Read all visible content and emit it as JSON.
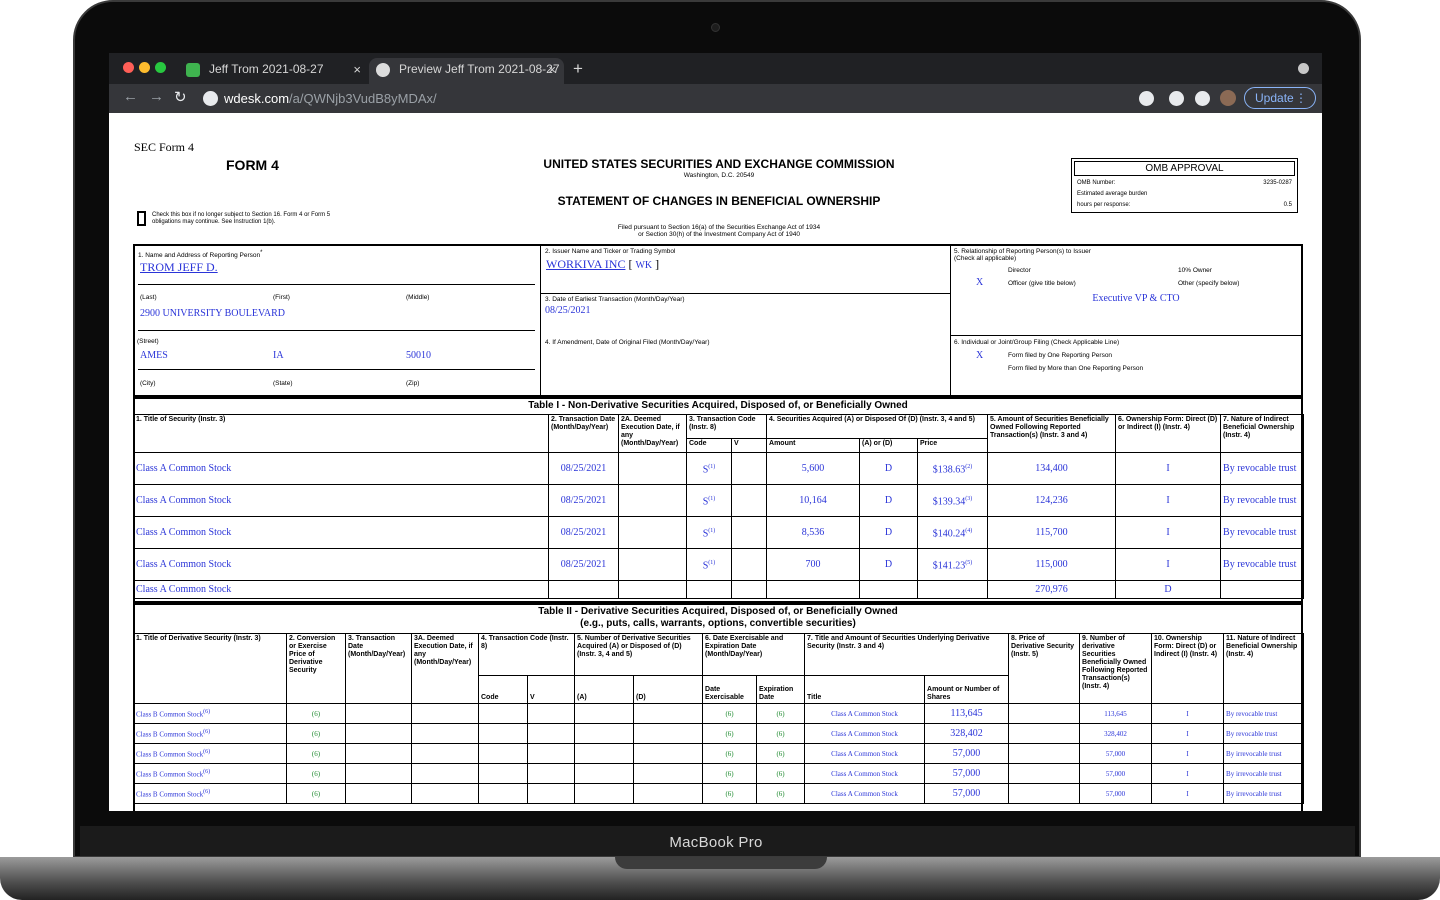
{
  "device": {
    "label": "MacBook Pro"
  },
  "browser": {
    "tabs": [
      {
        "label": "Jeff Trom 2021-08-27",
        "active": false
      },
      {
        "label": "Preview Jeff Trom 2021-08-27",
        "active": true
      }
    ],
    "url_domain": "wdesk.com",
    "url_path": "/a/QWNjb3VudB8yMDAx/",
    "update_label": "Update",
    "new_tab": "+",
    "close": "×",
    "icons": [
      "back-icon",
      "forward-icon",
      "reload-icon",
      "site-info-icon",
      "extension-icon",
      "profile-avatar",
      "menu-icon"
    ]
  },
  "form": {
    "sec_label": "SEC Form 4",
    "form_title": "FORM 4",
    "agency": "UNITED STATES SECURITIES AND EXCHANGE COMMISSION",
    "city": "Washington, D.C. 20549",
    "statement": "STATEMENT OF CHANGES IN BENEFICIAL OWNERSHIP",
    "filed1": "Filed pursuant to Section 16(a) of the Securities Exchange Act of 1934",
    "filed2": "or Section 30(h) of the Investment Company Act of 1940",
    "checkbox_text1": "Check this box if no longer subject to Section 16. Form 4 or Form 5",
    "checkbox_text2": "obligations may continue. See Instruction 1(b).",
    "omb": {
      "title": "OMB APPROVAL",
      "number_label": "OMB Number:",
      "number": "3235-0287",
      "burden_label": "Estimated average burden",
      "hours_label": "hours per response:",
      "hours": "0.5"
    },
    "box1": {
      "label": "1. Name and Address of Reporting Person",
      "mark": "*",
      "name": "TROM JEFF D.",
      "last": "(Last)",
      "first": "(First)",
      "middle": "(Middle)",
      "street_val": "2900 UNIVERSITY BOULEVARD",
      "street": "(Street)",
      "city_val": "AMES",
      "state_val": "IA",
      "zip_val": "50010",
      "city": "(City)",
      "state": "(State)",
      "zip": "(Zip)"
    },
    "box2": {
      "label": "2. Issuer Name and Ticker or Trading Symbol",
      "issuer": "WORKIVA INC",
      "ticker": "WK",
      "br_open": "[",
      "br_close": "]"
    },
    "box3": {
      "label": "3. Date of Earliest Transaction (Month/Day/Year)",
      "value": "08/25/2021"
    },
    "box4": {
      "label": "4. If Amendment, Date of Original Filed (Month/Day/Year)"
    },
    "box5": {
      "label1": "5. Relationship of Reporting Person(s) to Issuer",
      "label2": "(Check all applicable)",
      "director": "Director",
      "owner": "10% Owner",
      "x": "X",
      "officer": "Officer (give title below)",
      "other": "Other (specify below)",
      "title": "Executive VP & CTO"
    },
    "box6": {
      "label": "6. Individual or Joint/Group Filing (Check Applicable Line)",
      "x": "X",
      "one": "Form filed by One Reporting Person",
      "more": "Form filed by More than One Reporting Person"
    }
  },
  "table1": {
    "title": "Table I - Non-Derivative Securities Acquired, Disposed of, or Beneficially Owned",
    "headers": {
      "c1": "1. Title of Security (Instr. 3)",
      "c2": "2. Transaction Date (Month/Day/Year)",
      "c2a": "2A. Deemed Execution Date, if any (Month/Day/Year)",
      "c3": "3. Transaction Code (Instr. 8)",
      "c4": "4. Securities Acquired (A) or Disposed Of (D) (Instr. 3, 4 and 5)",
      "c5": "5. Amount of Securities Beneficially Owned Following Reported Transaction(s) (Instr. 3 and 4)",
      "c6": "6. Ownership Form: Direct (D) or Indirect (I) (Instr. 4)",
      "c7": "7. Nature of Indirect Beneficial Ownership (Instr. 4)",
      "code": "Code",
      "v": "V",
      "amount": "Amount",
      "ad": "(A) or (D)",
      "price": "Price"
    },
    "rows": [
      {
        "title": "Class A Common Stock",
        "date": "08/25/2021",
        "code": "S",
        "code_fn": "(1)",
        "amount": "5,600",
        "ad": "D",
        "price": "$138.63",
        "price_fn": "(2)",
        "owned": "134,400",
        "form": "I",
        "nature": "By revocable trust"
      },
      {
        "title": "Class A Common Stock",
        "date": "08/25/2021",
        "code": "S",
        "code_fn": "(1)",
        "amount": "10,164",
        "ad": "D",
        "price": "$139.34",
        "price_fn": "(3)",
        "owned": "124,236",
        "form": "I",
        "nature": "By revocable trust"
      },
      {
        "title": "Class A Common Stock",
        "date": "08/25/2021",
        "code": "S",
        "code_fn": "(1)",
        "amount": "8,536",
        "ad": "D",
        "price": "$140.24",
        "price_fn": "(4)",
        "owned": "115,700",
        "form": "I",
        "nature": "By revocable trust"
      },
      {
        "title": "Class A Common Stock",
        "date": "08/25/2021",
        "code": "S",
        "code_fn": "(1)",
        "amount": "700",
        "ad": "D",
        "price": "$141.23",
        "price_fn": "(5)",
        "owned": "115,000",
        "form": "I",
        "nature": "By revocable trust"
      },
      {
        "title": "Class A Common Stock",
        "date": "",
        "code": "",
        "code_fn": "",
        "amount": "",
        "ad": "",
        "price": "",
        "price_fn": "",
        "owned": "270,976",
        "form": "D",
        "nature": ""
      }
    ]
  },
  "table2": {
    "title1": "Table II - Derivative Securities Acquired, Disposed of, or Beneficially Owned",
    "title2": "(e.g., puts, calls, warrants, options, convertible securities)",
    "headers": {
      "c1": "1. Title of Derivative Security (Instr. 3)",
      "c2": "2. Conversion or Exercise Price of Derivative Security",
      "c3": "3. Transaction Date (Month/Day/Year)",
      "c3a": "3A. Deemed Execution Date, if any (Month/Day/Year)",
      "c4": "4. Transaction Code (Instr. 8)",
      "c5": "5. Number of Derivative Securities Acquired (A) or Disposed of (D) (Instr. 3, 4 and 5)",
      "c6": "6. Date Exercisable and Expiration Date (Month/Day/Year)",
      "c7": "7. Title and Amount of Securities Underlying Derivative Security (Instr. 3 and 4)",
      "c8": "8. Price of Derivative Security (Instr. 5)",
      "c9": "9. Number of derivative Securities Beneficially Owned Following Reported Transaction(s) (Instr. 4)",
      "c10": "10. Ownership Form: Direct (D) or Indirect (I) (Instr. 4)",
      "c11": "11. Nature of Indirect Beneficial Ownership (Instr. 4)",
      "code": "Code",
      "v": "V",
      "a": "(A)",
      "d": "(D)",
      "exer": "Date Exercisable",
      "exp": "Expiration Date",
      "title": "Title",
      "amt": "Amount or Number of Shares"
    },
    "rows": [
      {
        "title": "Class B Common Stock",
        "fn": "(6)",
        "price": "(6)",
        "exer": "(6)",
        "exp": "(6)",
        "under": "Class A Common Stock",
        "shares": "113,645",
        "owned": "113,645",
        "form": "I",
        "nature": "By revocable trust"
      },
      {
        "title": "Class B Common Stock",
        "fn": "(6)",
        "price": "(6)",
        "exer": "(6)",
        "exp": "(6)",
        "under": "Class A Common Stock",
        "shares": "328,402",
        "owned": "328,402",
        "form": "I",
        "nature": "By revocable trust"
      },
      {
        "title": "Class B Common Stock",
        "fn": "(6)",
        "price": "(6)",
        "exer": "(6)",
        "exp": "(6)",
        "under": "Class A Common Stock",
        "shares": "57,000",
        "owned": "57,000",
        "form": "I",
        "nature": "By irrevocable trust"
      },
      {
        "title": "Class B Common Stock",
        "fn": "(6)",
        "price": "(6)",
        "exer": "(6)",
        "exp": "(6)",
        "under": "Class A Common Stock",
        "shares": "57,000",
        "owned": "57,000",
        "form": "I",
        "nature": "By irrevocable trust"
      },
      {
        "title": "Class B Common Stock",
        "fn": "(6)",
        "price": "(6)",
        "exer": "(6)",
        "exp": "(6)",
        "under": "Class A Common Stock",
        "shares": "57,000",
        "owned": "57,000",
        "form": "I",
        "nature": "By irrevocable trust"
      }
    ]
  }
}
